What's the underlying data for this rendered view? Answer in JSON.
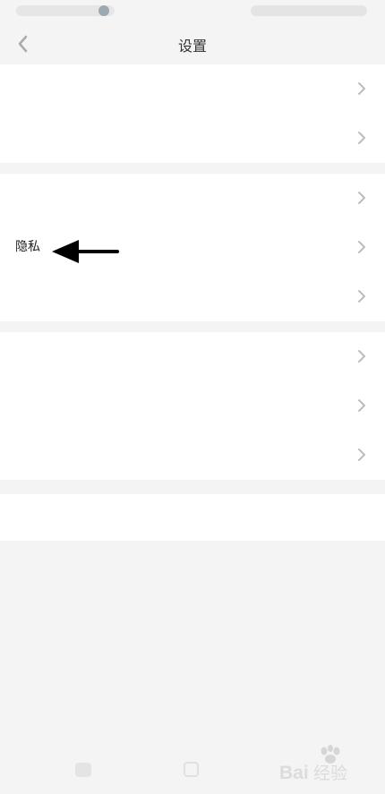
{
  "header": {
    "title": "设置",
    "back_icon": "chevron-left-icon"
  },
  "groups": [
    {
      "items": [
        {
          "label": "",
          "value": "",
          "chevron": true
        },
        {
          "label": "",
          "value": "",
          "chevron": true
        }
      ]
    },
    {
      "items": [
        {
          "label": "",
          "value": "",
          "chevron": true
        },
        {
          "label": "隐私",
          "value": "",
          "chevron": true
        },
        {
          "label": "",
          "value": "",
          "chevron": true
        }
      ]
    },
    {
      "items": [
        {
          "label": "",
          "value": "",
          "chevron": true
        },
        {
          "label": "",
          "value": "",
          "chevron": true
        },
        {
          "label": "",
          "value": "",
          "chevron": true
        }
      ]
    }
  ],
  "logout": {
    "label": ""
  },
  "annotation": {
    "type": "arrow",
    "pointing_to": "隐私",
    "color": "#000000"
  },
  "watermark": {
    "text": "Bai经验",
    "icon": "paw-icon"
  },
  "nav": {
    "back_icon": "nav-back-icon",
    "home_icon": "nav-home-icon"
  },
  "colors": {
    "background": "#f4f4f4",
    "row": "#ffffff",
    "text": "#222222",
    "chevron": "#bdbdbd"
  }
}
